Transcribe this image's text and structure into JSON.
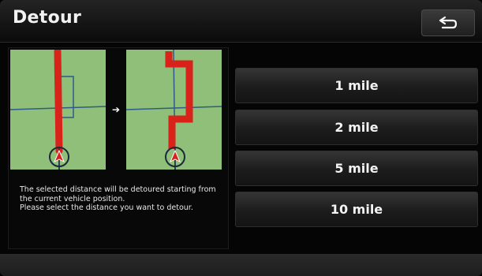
{
  "header": {
    "title": "Detour",
    "back_icon": "back-return-icon"
  },
  "illustration": {
    "before_map_icon": "map-straight-route-icon",
    "after_map_icon": "map-detour-route-icon",
    "arrow_icon": "right-arrow-icon",
    "colors": {
      "map": "#8fbf78",
      "route": "#d8221a",
      "road": "#2f5a8a"
    }
  },
  "description": {
    "line1": "The selected distance will be detoured starting from the current vehicle position.",
    "line2": "Please select the distance you want to detour."
  },
  "options": [
    {
      "label": "1 mile"
    },
    {
      "label": "2 mile"
    },
    {
      "label": "5 mile"
    },
    {
      "label": "10 mile"
    }
  ]
}
